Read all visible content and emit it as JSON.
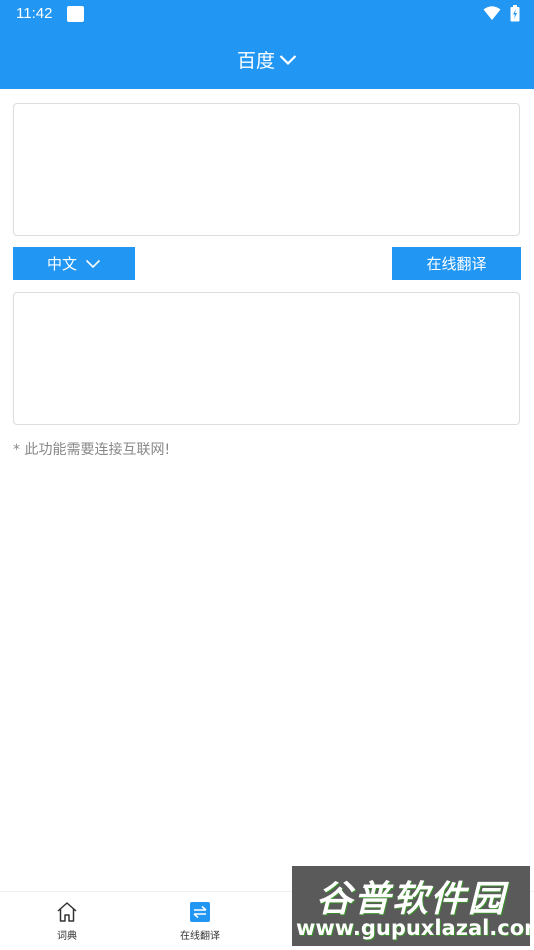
{
  "status_bar": {
    "time": "11:42"
  },
  "app_bar": {
    "title": "百度"
  },
  "source": {
    "text": ""
  },
  "language": {
    "selected": "中文"
  },
  "actions": {
    "translate_label": "在线翻译"
  },
  "result": {
    "text": ""
  },
  "notice": {
    "text": "* 此功能需要连接互联网!"
  },
  "bottom_nav": {
    "items": [
      {
        "label": "词典",
        "icon": "home-icon"
      },
      {
        "label": "在线翻译",
        "icon": "swap-icon"
      },
      {
        "label": "",
        "icon": ""
      },
      {
        "label": "",
        "icon": ""
      }
    ]
  },
  "watermark": {
    "title": "谷普软件园",
    "url": "www.gupuxlazal.com"
  },
  "colors": {
    "primary": "#2196f3",
    "border": "#dddddd",
    "notice_text": "#888888"
  }
}
